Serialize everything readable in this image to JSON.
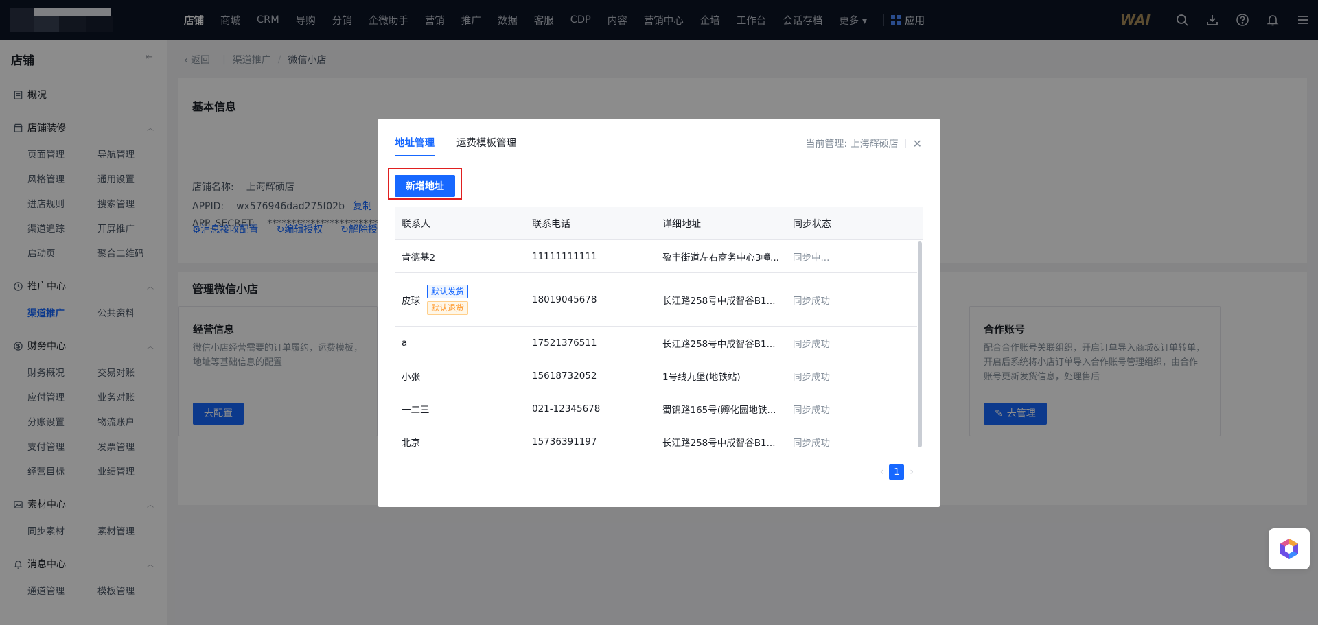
{
  "topnav": {
    "items": [
      "店铺",
      "商城",
      "CRM",
      "导购",
      "分销",
      "企微助手",
      "营销",
      "推广",
      "数据",
      "客服",
      "CDP",
      "内容",
      "营销中心",
      "企培",
      "工作台",
      "会话存档",
      "更多 ▾"
    ],
    "app_label": "应用",
    "brand": "WAI",
    "icons": [
      "search-icon",
      "download-icon",
      "help-icon",
      "bell-icon",
      "menu-icon"
    ]
  },
  "sidebar": {
    "title": "店铺",
    "collapse_icon": "⇤",
    "overview": "概况",
    "sections": {
      "decor": {
        "label": "店铺装修",
        "items": [
          "页面管理",
          "导航管理",
          "风格管理",
          "通用设置",
          "进店规则",
          "搜索管理",
          "渠道追踪",
          "开屏推广",
          "启动页",
          "聚合二维码"
        ]
      },
      "promo": {
        "label": "推广中心",
        "items": [
          "渠道推广",
          "公共资料"
        ]
      },
      "finance": {
        "label": "财务中心",
        "items": [
          "财务概况",
          "交易对账",
          "应付管理",
          "业务对账",
          "分账设置",
          "物流账户",
          "支付管理",
          "发票管理",
          "经营目标",
          "业绩管理"
        ]
      },
      "material": {
        "label": "素材中心",
        "items": [
          "同步素材",
          "素材管理"
        ]
      },
      "message": {
        "label": "消息中心",
        "items": [
          "通道管理",
          "模板管理"
        ]
      }
    }
  },
  "breadcrumb": {
    "back": "返回",
    "parent": "渠道推广",
    "sep": "/",
    "current": "微信小店"
  },
  "basic": {
    "title": "基本信息",
    "shop_label": "店铺名称:",
    "shop_value": "上海辉硕店",
    "appid_label": "APPID:",
    "appid_value": "wx576946dad275f02b",
    "copy": "复制",
    "secret_label": "APP_SECRET:",
    "secret_value": "******************************",
    "links": [
      "⚙消息接收配置",
      "↻编辑授权",
      "↻解除授权"
    ]
  },
  "manage": {
    "title": "管理微信小店",
    "ops": {
      "title": "经营信息",
      "desc": "微信小店经营需要的订单履约，运费模板，地址等基础信息的配置",
      "btn": "去配置"
    },
    "partner": {
      "title": "合作账号",
      "desc": "配合合作账号关联组织，开启订单导入商城&订单转单，开启后系统将小店订单导入合作账号管理组织，由合作账号更新发货信息，处理售后",
      "btn": "去管理"
    }
  },
  "dialog": {
    "tabs": [
      "地址管理",
      "运费模板管理"
    ],
    "manager_label": "当前管理: 上海辉硕店",
    "close": "✕",
    "add_button": "新增地址",
    "columns": [
      "联系人",
      "联系电话",
      "详细地址",
      "同步状态"
    ],
    "rows": [
      {
        "name": "肯德基2",
        "phone": "11111111111",
        "address": "盈丰街道左右商务中心3幢...",
        "status": "同步中..."
      },
      {
        "name": "皮球",
        "phone": "18019045678",
        "address": "长江路258号中成智谷B1...",
        "status": "同步成功",
        "tags": [
          "默认发货",
          "默认退货"
        ]
      },
      {
        "name": "a",
        "phone": "17521376511",
        "address": "长江路258号中成智谷B1...",
        "status": "同步成功"
      },
      {
        "name": "小张",
        "phone": "15618732052",
        "address": "1号线九堡(地铁站)",
        "status": "同步成功"
      },
      {
        "name": "一二三",
        "phone": "021-12345678",
        "address": "蜀锦路165号(孵化园地铁...",
        "status": "同步成功"
      },
      {
        "name": "北京",
        "phone": "15736391197",
        "address": "长江路258号中成智谷B1...",
        "status": "同步成功"
      }
    ],
    "pagination": {
      "prev": "‹",
      "current": "1",
      "next": "›"
    }
  }
}
